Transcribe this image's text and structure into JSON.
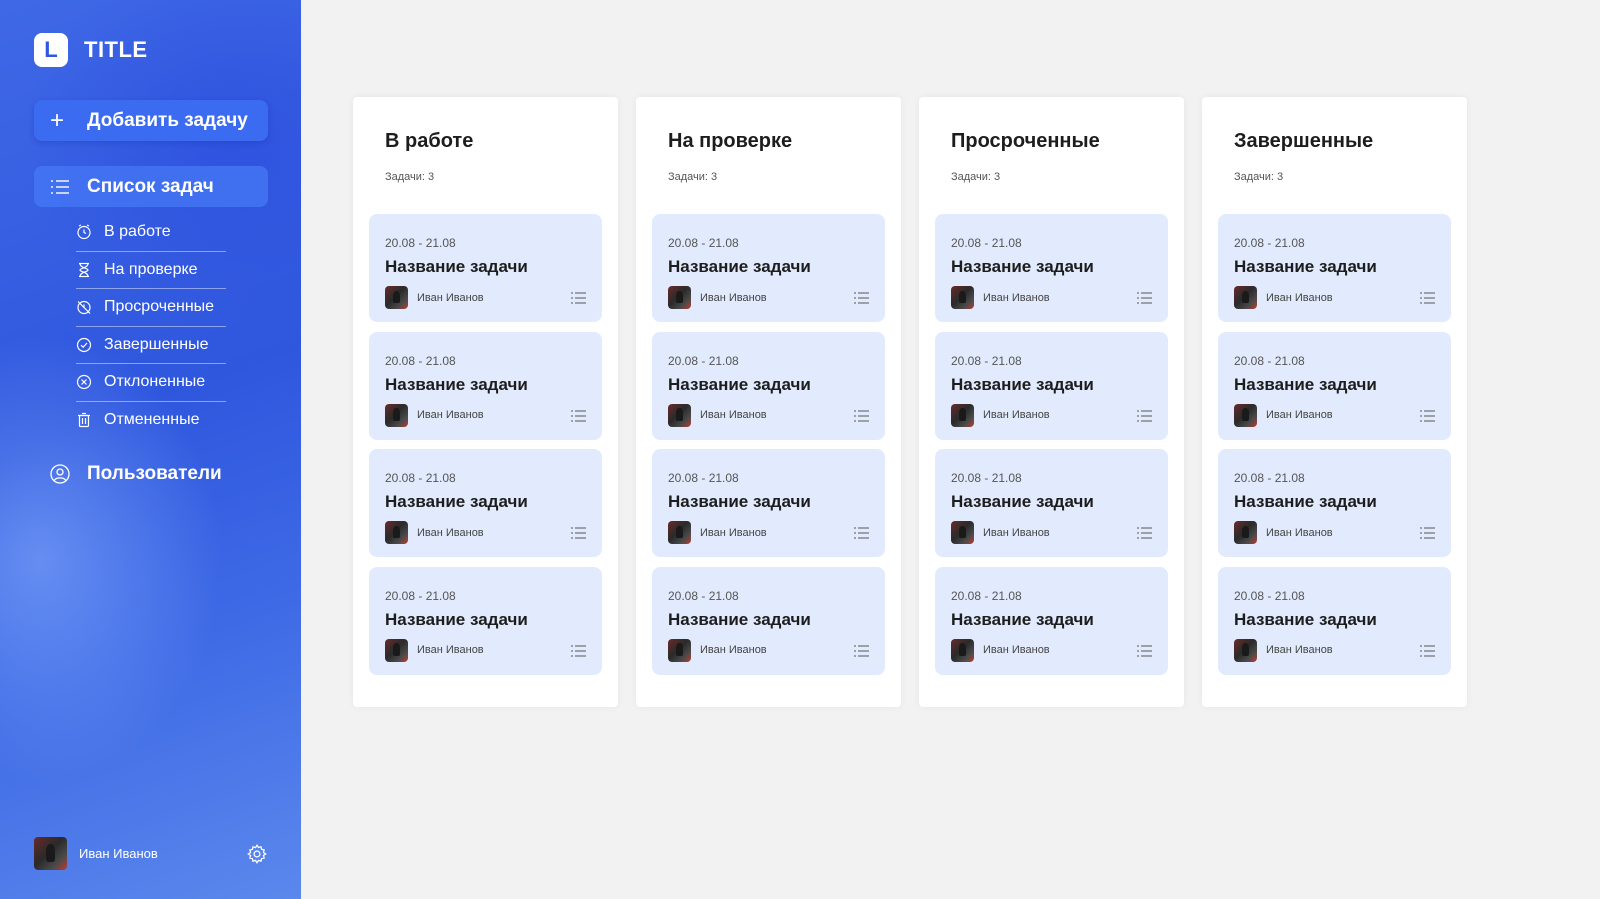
{
  "app": {
    "logo_letter": "L",
    "title": "TITLE"
  },
  "sidebar": {
    "add_button": "Добавить задачу",
    "task_list": "Список задач",
    "items": [
      {
        "label": "В работе",
        "icon": "clock-icon"
      },
      {
        "label": "На проверке",
        "icon": "hourglass-icon"
      },
      {
        "label": "Просроченные",
        "icon": "clock-crossed-icon"
      },
      {
        "label": "Завершенные",
        "icon": "check-circle-icon"
      },
      {
        "label": "Отклоненные",
        "icon": "x-circle-icon"
      },
      {
        "label": "Отмененные",
        "icon": "trash-icon"
      }
    ],
    "users": "Пользователи",
    "profile_name": "Иван Иванов"
  },
  "board": {
    "columns": [
      {
        "title": "В работе",
        "count": "Задачи: 3",
        "cards": [
          {
            "date": "20.08 - 21.08",
            "title": "Название задачи",
            "assignee": "Иван Иванов"
          },
          {
            "date": "20.08 - 21.08",
            "title": "Название задачи",
            "assignee": "Иван Иванов"
          },
          {
            "date": "20.08 - 21.08",
            "title": "Название задачи",
            "assignee": "Иван Иванов"
          },
          {
            "date": "20.08 - 21.08",
            "title": "Название задачи",
            "assignee": "Иван Иванов"
          }
        ]
      },
      {
        "title": "На проверке",
        "count": "Задачи: 3",
        "cards": [
          {
            "date": "20.08 - 21.08",
            "title": "Название задачи",
            "assignee": "Иван Иванов"
          },
          {
            "date": "20.08 - 21.08",
            "title": "Название задачи",
            "assignee": "Иван Иванов"
          },
          {
            "date": "20.08 - 21.08",
            "title": "Название задачи",
            "assignee": "Иван Иванов"
          },
          {
            "date": "20.08 - 21.08",
            "title": "Название задачи",
            "assignee": "Иван Иванов"
          }
        ]
      },
      {
        "title": "Просроченные",
        "count": "Задачи: 3",
        "cards": [
          {
            "date": "20.08 - 21.08",
            "title": "Название задачи",
            "assignee": "Иван Иванов"
          },
          {
            "date": "20.08 - 21.08",
            "title": "Название задачи",
            "assignee": "Иван Иванов"
          },
          {
            "date": "20.08 - 21.08",
            "title": "Название задачи",
            "assignee": "Иван Иванов"
          },
          {
            "date": "20.08 - 21.08",
            "title": "Название задачи",
            "assignee": "Иван Иванов"
          }
        ]
      },
      {
        "title": "Завершенные",
        "count": "Задачи: 3",
        "cards": [
          {
            "date": "20.08 - 21.08",
            "title": "Название задачи",
            "assignee": "Иван Иванов"
          },
          {
            "date": "20.08 - 21.08",
            "title": "Название задачи",
            "assignee": "Иван Иванов"
          },
          {
            "date": "20.08 - 21.08",
            "title": "Название задачи",
            "assignee": "Иван Иванов"
          },
          {
            "date": "20.08 - 21.08",
            "title": "Название задачи",
            "assignee": "Иван Иванов"
          }
        ]
      }
    ]
  },
  "colors": {
    "sidebar_blue": "#3157e0",
    "card_bg": "#e2ebfd",
    "page_bg": "#f2f2f2"
  }
}
